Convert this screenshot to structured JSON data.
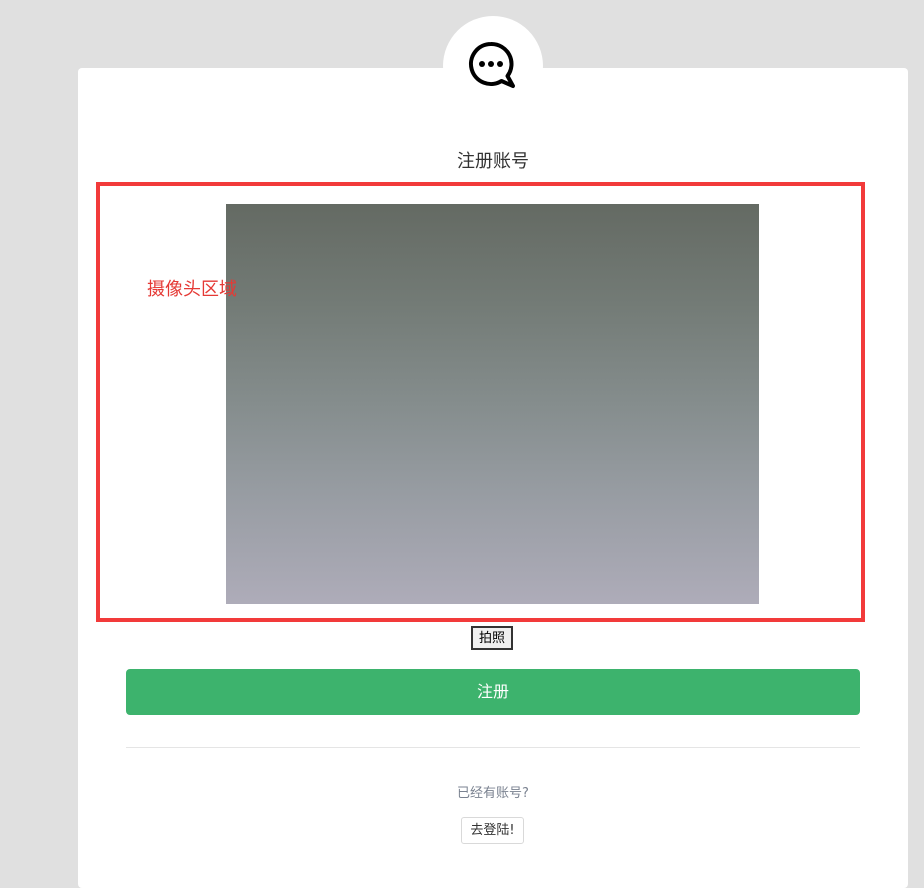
{
  "logo": {
    "icon": "chat-bubble-icon"
  },
  "title": "注册账号",
  "camera": {
    "label": "摄像头区域"
  },
  "capture_button": "拍照",
  "register_button": "注册",
  "login": {
    "prompt": "已经有账号?",
    "button": "去登陆!"
  },
  "colors": {
    "background": "#e0e0e0",
    "accent_green": "#3db36d",
    "highlight_red": "#f23a3a"
  }
}
